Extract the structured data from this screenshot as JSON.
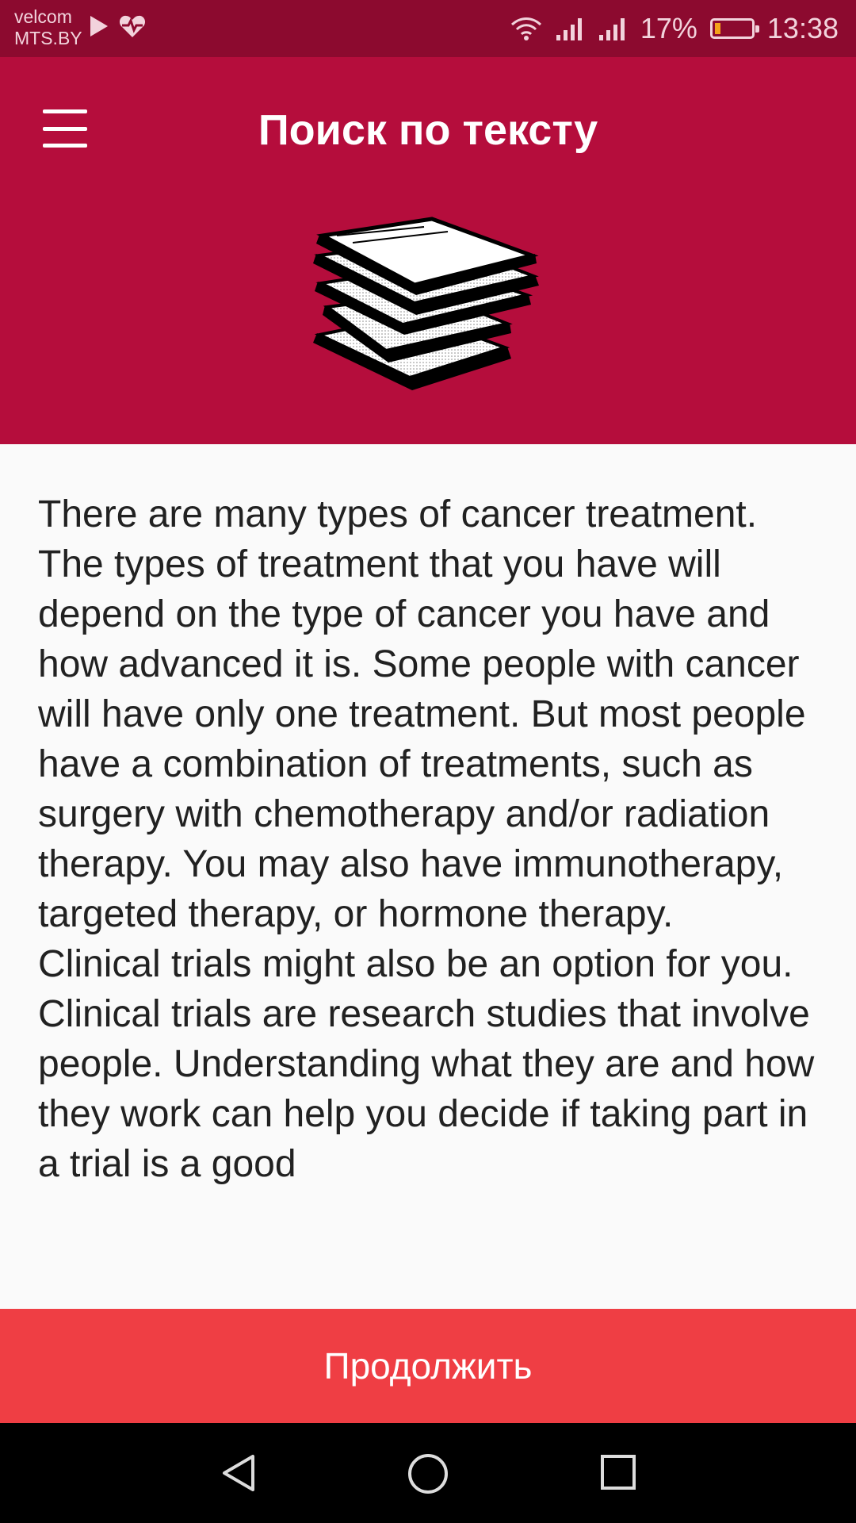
{
  "status_bar": {
    "carrier_line1": "velcom",
    "carrier_line2": "MTS.BY",
    "battery_percent": "17%",
    "battery_level": 0.17,
    "time": "13:38",
    "icons": [
      "play-icon",
      "heart-monitor-icon",
      "wifi-icon",
      "signal-icon",
      "signal-icon",
      "battery-icon"
    ]
  },
  "app_bar": {
    "title": "Поиск по тексту",
    "menu_icon": "hamburger-menu-icon"
  },
  "header": {
    "illustration": "stack-of-books-icon"
  },
  "content": {
    "paragraph1": "There are many types of cancer treatment. The types of treatment that you have will depend on the type of cancer you have and how advanced it is. Some people with cancer will have only one treatment. But most people have a combination of treatments, such as surgery with chemotherapy and/or radiation therapy. You may also have immunotherapy, targeted therapy, or hormone therapy.",
    "paragraph2": "Clinical trials might also be an option for you. Clinical trials are research studies that involve people. Understanding what they are and how they work can help you decide if taking part in a trial is a good"
  },
  "actions": {
    "continue_label": "Продолжить"
  },
  "navigation": {
    "back": "back-triangle-icon",
    "home": "home-circle-icon",
    "recents": "recents-square-icon"
  },
  "colors": {
    "status_bar": "#8c0a2f",
    "header": "#b50d3c",
    "button": "#ef3e44",
    "background": "#fafafa",
    "text": "#212121"
  }
}
